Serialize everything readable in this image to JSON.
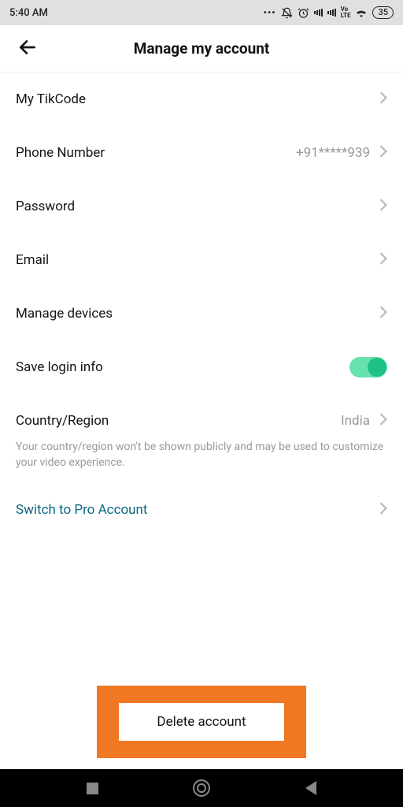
{
  "status": {
    "time": "5:40 AM",
    "battery": "35"
  },
  "header": {
    "title": "Manage my account"
  },
  "rows": {
    "tikcode": "My TikCode",
    "phone_label": "Phone Number",
    "phone_value": "+91*****939",
    "password": "Password",
    "email": "Email",
    "manage_devices": "Manage devices",
    "save_login": "Save login info",
    "country_label": "Country/Region",
    "country_value": "India",
    "country_helper": "Your country/region won't be shown publicly and may be used to customize your video experience.",
    "switch_pro": "Switch to Pro Account"
  },
  "delete": {
    "label": "Delete account"
  }
}
